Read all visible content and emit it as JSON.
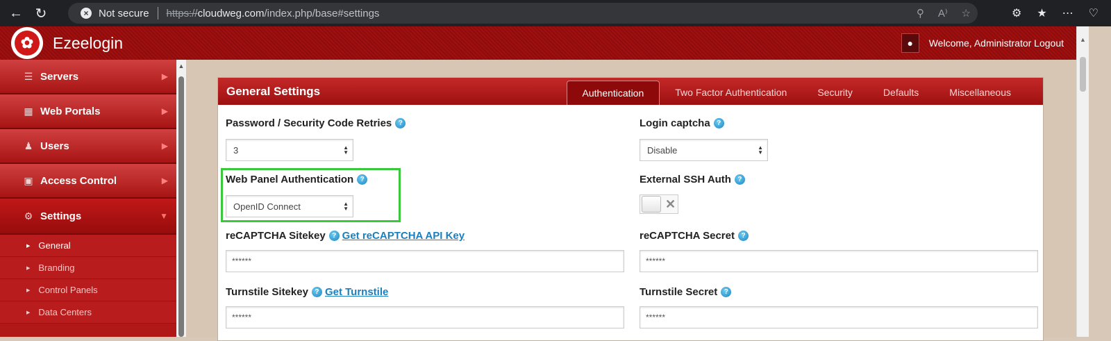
{
  "browser": {
    "security_label": "Not secure",
    "url_protocol": "https://",
    "url_domain": "cloudweg.com",
    "url_path": "/index.php/base#settings"
  },
  "header": {
    "app_title": "Ezeelogin",
    "welcome": "Welcome, Administrator Logout"
  },
  "sidebar": {
    "items": [
      {
        "label": "Servers",
        "icon": "list-icon"
      },
      {
        "label": "Web Portals",
        "icon": "dashboard-icon"
      },
      {
        "label": "Users",
        "icon": "users-icon"
      },
      {
        "label": "Access Control",
        "icon": "lock-icon"
      },
      {
        "label": "Settings",
        "icon": "gears-icon"
      }
    ],
    "sub_items": [
      "General",
      "Branding",
      "Control Panels",
      "Data Centers"
    ]
  },
  "panel": {
    "title": "General Settings",
    "tabs": [
      "Authentication",
      "Two Factor Authentication",
      "Security",
      "Defaults",
      "Miscellaneous"
    ]
  },
  "form": {
    "retries_label": "Password / Security Code Retries",
    "retries_value": "3",
    "captcha_label": "Login captcha",
    "captcha_value": "Disable",
    "web_auth_label": "Web Panel Authentication",
    "web_auth_value": "OpenID Connect",
    "ext_ssh_label": "External SSH Auth",
    "ext_ssh_state": "off",
    "recaptcha_sitekey_label": "reCAPTCHA Sitekey",
    "recaptcha_link": "Get reCAPTCHA API Key",
    "recaptcha_sitekey_value": "******",
    "recaptcha_secret_label": "reCAPTCHA Secret",
    "recaptcha_secret_value": "******",
    "turnstile_sitekey_label": "Turnstile Sitekey",
    "turnstile_link": "Get Turnstile",
    "turnstile_sitekey_value": "******",
    "turnstile_secret_label": "Turnstile Secret",
    "turnstile_secret_value": "******"
  },
  "colors": {
    "accent": "#b01818",
    "highlight": "#3cc83c",
    "link": "#1a7fbf"
  }
}
